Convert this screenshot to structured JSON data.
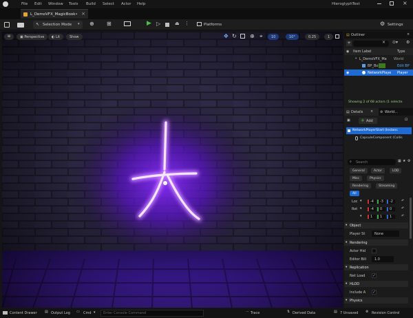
{
  "title_bar": {
    "menu": [
      "File",
      "Edit",
      "Window",
      "Tools",
      "Build",
      "Select",
      "Actor",
      "Help"
    ],
    "project_name": "HieroglyphTest"
  },
  "tab": {
    "label": "L_DemoVFX_MagicBook•"
  },
  "toolbar": {
    "selection_mode": "Selection Mode",
    "platforms": "Platforms",
    "settings": "Settings"
  },
  "viewport_toolbar": {
    "perspective": "Perspective",
    "lit": "Lit",
    "show": "Show",
    "grid_value": "10",
    "angle_value": "10°",
    "scale_value": "0.25",
    "cam_speed": "1"
  },
  "viewport": {
    "glyph_color": "#b455ff",
    "glyph_core": "#f5e6ff"
  },
  "outliner": {
    "title": "Outliner",
    "col_item": "Item Label",
    "col_type": "Type",
    "rows": [
      {
        "label": "L_DemoVFX_Ma",
        "type": "World"
      },
      {
        "label": "BP_Bo",
        "type": "Edit BP"
      },
      {
        "label": "NetworkPlaye",
        "type": "Player"
      }
    ],
    "status": "Showing 2 of 68 actors (1 selecte"
  },
  "details": {
    "tab1": "Details",
    "tab2": "World...",
    "add": "Add",
    "component_root": "NetworkPlayerStart (Instanc",
    "component_child": "CapsuleComponent (Collis",
    "search_placeholder": "Search",
    "filters": [
      "General",
      "Actor",
      "LOD",
      "Misc",
      "Physics",
      "Rendering",
      "Streaming",
      "All"
    ],
    "transform": [
      {
        "label": "Loc",
        "x": "-4",
        "y": "-3",
        "z": "-2"
      },
      {
        "label": "Rot",
        "x": "-4",
        "y": "0",
        "z": "0"
      },
      {
        "label": "",
        "x": "1",
        "y": "1",
        "z": "1"
      }
    ],
    "sections": {
      "object": "Object",
      "rendering": "Rendering",
      "replication": "Replication",
      "hlod": "HLOD",
      "physics": "Physics"
    },
    "props": {
      "player_start_label": "Player St",
      "player_start_value": "None",
      "actor_hidden_label": "Actor Hid",
      "editor_bill_label": "Editor Bill",
      "editor_bill_value": "1.0",
      "net_load_label": "Net Load",
      "include_label": "Include A"
    }
  },
  "status_bar": {
    "content_drawer": "Content Drawer",
    "output_log": "Output Log",
    "cmd": "Cmd",
    "console_placeholder": "Enter Console Command",
    "trace": "Trace",
    "derived_data": "Derived Data",
    "unsaved": "7 Unsaved",
    "revision": "Revision Control"
  }
}
